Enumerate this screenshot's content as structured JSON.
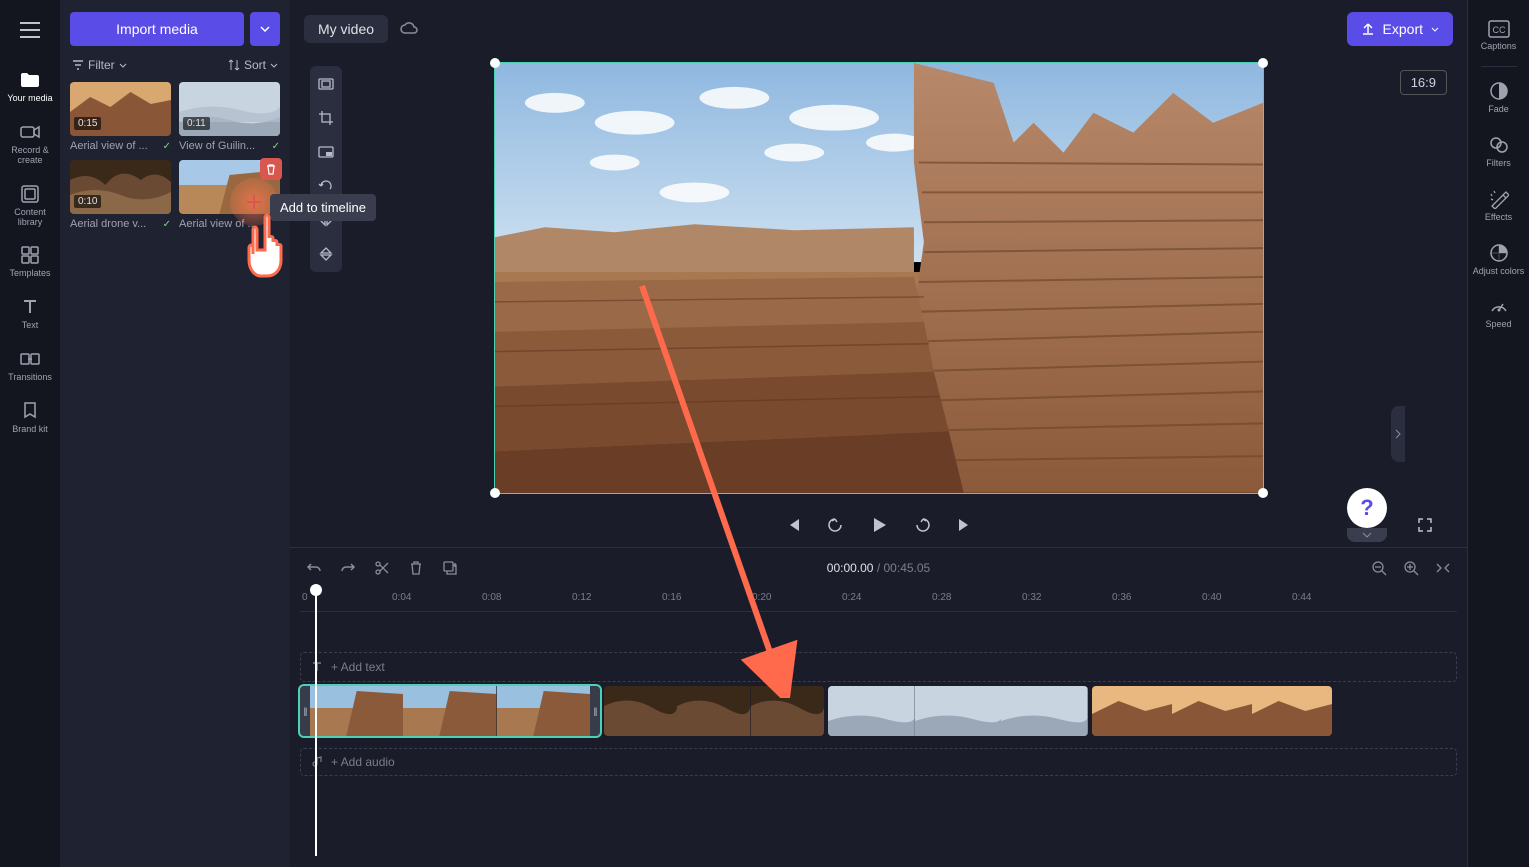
{
  "nav": {
    "items": [
      {
        "label": "Your media"
      },
      {
        "label": "Record & create"
      },
      {
        "label": "Content library"
      },
      {
        "label": "Templates"
      },
      {
        "label": "Text"
      },
      {
        "label": "Transitions"
      },
      {
        "label": "Brand kit"
      }
    ]
  },
  "media_panel": {
    "import_label": "Import media",
    "filter_label": "Filter",
    "sort_label": "Sort",
    "items": [
      {
        "duration": "0:15",
        "label": "Aerial view of ..."
      },
      {
        "duration": "0:11",
        "label": "View of Guilin..."
      },
      {
        "duration": "0:10",
        "label": "Aerial drone v..."
      },
      {
        "duration": "",
        "label": "Aerial view of ..."
      }
    ],
    "tooltip": "Add to timeline"
  },
  "topbar": {
    "title": "My video",
    "export_label": "Export",
    "aspect": "16:9"
  },
  "right_rail": {
    "items": [
      {
        "label": "Captions"
      },
      {
        "label": "Fade"
      },
      {
        "label": "Filters"
      },
      {
        "label": "Effects"
      },
      {
        "label": "Adjust colors"
      },
      {
        "label": "Speed"
      }
    ]
  },
  "timeline": {
    "current": "00:00.00",
    "duration": "00:45.05",
    "add_text_label": "+ Add text",
    "add_audio_label": "+ Add audio",
    "ruler_ticks": [
      "0",
      "0:04",
      "0:08",
      "0:12",
      "0:16",
      "0:20",
      "0:24",
      "0:28",
      "0:32",
      "0:36",
      "0:40",
      "0:44"
    ]
  },
  "colors": {
    "accent": "#5a4ce6",
    "selection": "#4dd0b8",
    "danger": "#d9574e",
    "annotation": "#ff6a4d"
  }
}
